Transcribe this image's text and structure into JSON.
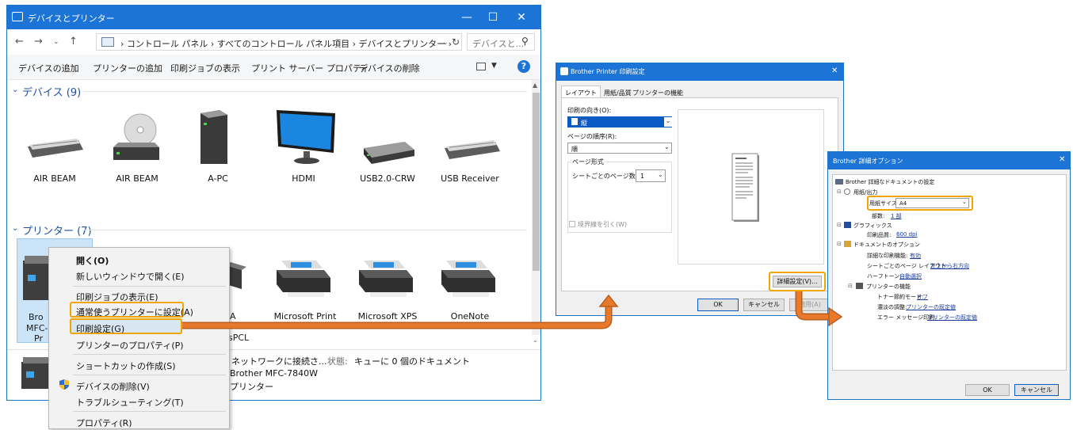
{
  "explorer": {
    "title": "デバイスとプリンター",
    "breadcrumb": "›  コントロール パネル  ›  すべてのコントロール パネル項目  ›  デバイスとプリンター  ›",
    "search_placeholder": "デバイスと...",
    "toolbar": [
      "デバイスの追加",
      "プリンターの追加",
      "印刷ジョブの表示",
      "プリント サーバー プロパティ",
      "デバイスの削除"
    ],
    "devices_section": "デバイス (9)",
    "devices": [
      "AIR BEAM",
      "AIR BEAM",
      "A-PC",
      "HDMI",
      "USB2.0-CRW",
      "USB Receiver"
    ],
    "printers_section": "プリンター (7)",
    "printers_visible": [
      "Microsoft Print",
      "Microsoft XPS",
      "OneNote"
    ],
    "partial_labels": {
      "bro": "Bro",
      "mfc": "MFC-",
      "pr": "Pr",
      "a": "A",
      "spcl": "sPCL"
    },
    "status": {
      "network": "ネットワークに接続さ...",
      "state_label": "状態:",
      "queue": "キューに 0 個のドキュメント",
      "model": "Brother MFC-7840W",
      "category": "プリンター"
    }
  },
  "context_menu": {
    "items": [
      "開く(O)",
      "新しいウィンドウで開く(E)",
      "印刷ジョブの表示(E)",
      "通常使うプリンターに設定(A)",
      "印刷設定(G)",
      "プリンターのプロパティ(P)",
      "ショートカットの作成(S)",
      "デバイスの削除(V)",
      "トラブルシューティング(T)",
      "プロパティ(R)"
    ]
  },
  "print_settings": {
    "title": "Brother Printer 印刷設定",
    "tabs": [
      "レイアウト",
      "用紙/品質",
      "プリンターの機能"
    ],
    "orientation_label": "印刷の向き(O):",
    "orientation_value": "縦",
    "page_order_label": "ページの順序(R):",
    "page_order_value": "順",
    "page_format_label": "ページ形式",
    "pages_per_sheet_label": "シートごとのページ数(S)",
    "pages_per_sheet_value": "1",
    "border_label": "境界線を引く(W)",
    "advanced_button": "詳細設定(V)...",
    "ok": "OK",
    "cancel": "キャンセル",
    "apply": "適用(A)"
  },
  "advanced_options": {
    "title": "Brother 詳細オプション",
    "root": "Brother 詳細なドキュメントの設定",
    "paper_output": "用紙/出力",
    "paper_size_label": "用紙サイズ:",
    "paper_size_value": "A4",
    "copies_label": "部数:",
    "copies_value": "1 部",
    "graphics": "グラフィックス",
    "print_quality_label": "印刷品質:",
    "print_quality_value": "600 dpi",
    "doc_options": "ドキュメントのオプション",
    "adv_print_label": "詳細な印刷機能:",
    "adv_print_value": "有効",
    "page_layout_label": "シートごとのページ レイアウト:",
    "page_layout_value": "左上から右方向",
    "halftone_label": "ハーフトーン:",
    "halftone_value": "自動選択",
    "printer_features": "プリンターの機能",
    "toner_label": "トナー節約モード:",
    "toner_value": "オフ",
    "density_label": "濃淡の調整:",
    "density_value": "プリンターの既定値",
    "error_label": "エラー メッセージ印刷:",
    "error_value": "プリンターの既定値",
    "ok": "OK",
    "cancel": "キャンセル"
  },
  "colors": {
    "accent": "#1b74d6",
    "highlight": "#f0a500",
    "arrow": "#e3762b"
  }
}
